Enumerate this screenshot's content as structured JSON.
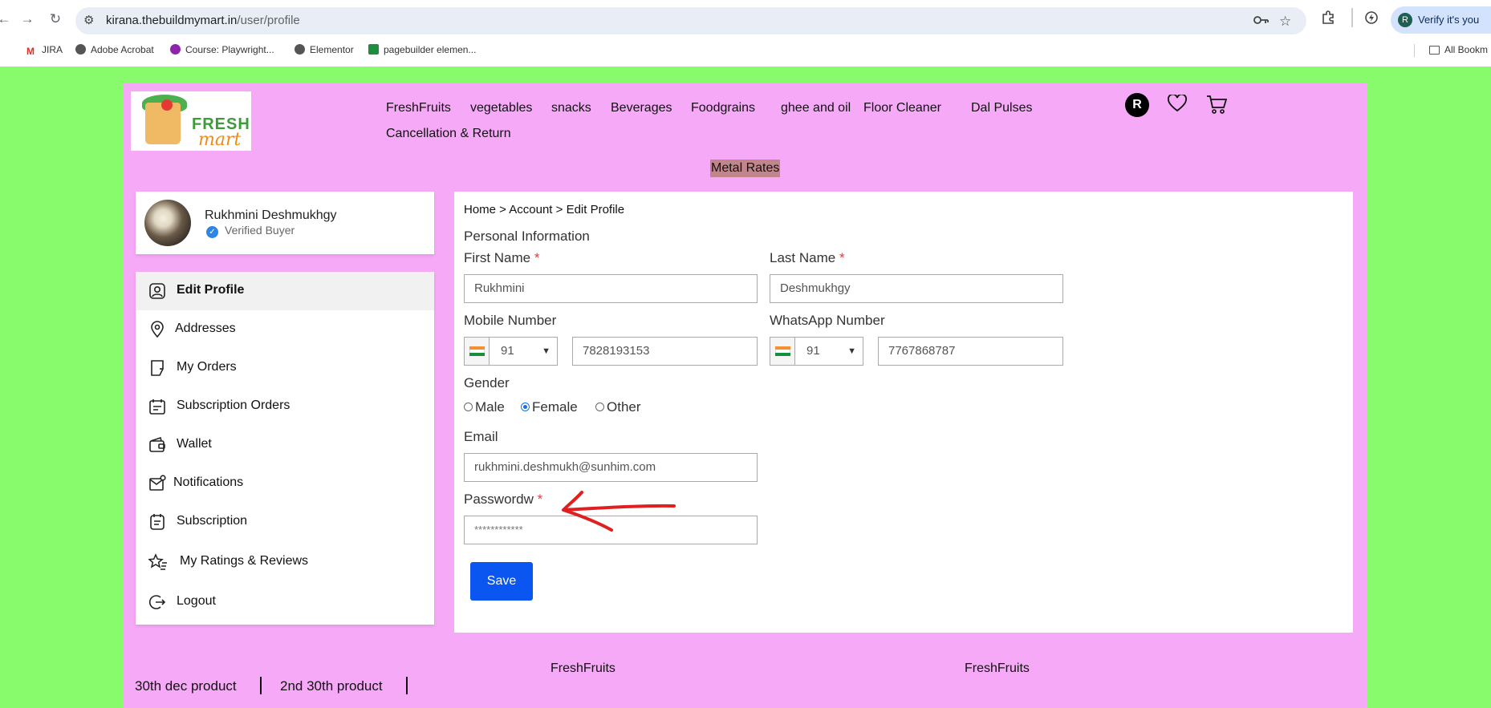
{
  "browser": {
    "url_host": "kirana.thebuildmymart.in",
    "url_path": "/user/profile",
    "verify_label": "Verify it's you",
    "profile_initial": "R",
    "bookmarks": [
      "JIRA",
      "Adobe Acrobat",
      "Course: Playwright...",
      "Elementor",
      "pagebuilder elemen..."
    ],
    "all_bookmarks": "All Bookm"
  },
  "header": {
    "logo_fresh": "FRESH",
    "logo_mart": "mart",
    "menu": [
      "FreshFruits",
      "vegetables",
      "snacks",
      "Beverages",
      "Foodgrains",
      "ghee and oil",
      "Floor Cleaner",
      "Dal Pulses",
      "Cancellation & Return"
    ],
    "user_initial": "R",
    "metal_rates": "Metal Rates"
  },
  "profile": {
    "name": "Rukhmini Deshmukhgy",
    "status": "Verified Buyer"
  },
  "sidebar": {
    "items": [
      {
        "label": "Edit Profile",
        "icon": "user-icon"
      },
      {
        "label": "Addresses",
        "icon": "location-pin-icon"
      },
      {
        "label": "My Orders",
        "icon": "orders-icon"
      },
      {
        "label": "Subscription Orders",
        "icon": "subscription-orders-icon"
      },
      {
        "label": "Wallet",
        "icon": "wallet-icon"
      },
      {
        "label": "Notifications",
        "icon": "notification-icon"
      },
      {
        "label": "Subscription",
        "icon": "subscription-icon"
      },
      {
        "label": "My Ratings & Reviews",
        "icon": "star-list-icon"
      },
      {
        "label": "Logout",
        "icon": "logout-icon"
      }
    ]
  },
  "form": {
    "breadcrumb": "Home > Account > Edit Profile",
    "section_title": "Personal Information",
    "first_name_label": "First Name",
    "first_name_value": "Rukhmini",
    "last_name_label": "Last Name",
    "last_name_value": "Deshmukhgy",
    "mobile_label": "Mobile Number",
    "mobile_code": "91",
    "mobile_value": "7828193153",
    "whatsapp_label": "WhatsApp Number",
    "whatsapp_code": "91",
    "whatsapp_value": "7767868787",
    "gender_label": "Gender",
    "gender_options": [
      "Male",
      "Female",
      "Other"
    ],
    "gender_selected": "Female",
    "email_label": "Email",
    "email_value": "rukhmini.deshmukh@sunhim.com",
    "password_label": "Passwordw",
    "required_mark": "*",
    "password_value": "************",
    "save_label": "Save"
  },
  "footer": {
    "links": [
      "FreshFruits",
      "FreshFruits"
    ],
    "products": [
      "30th dec product",
      "2nd 30th product"
    ]
  },
  "colors": {
    "page_bg": "#87fb6b",
    "site_bg": "#f6a9f7",
    "save_button": "#0b55f0",
    "annotation_arrow": "#e02020"
  }
}
